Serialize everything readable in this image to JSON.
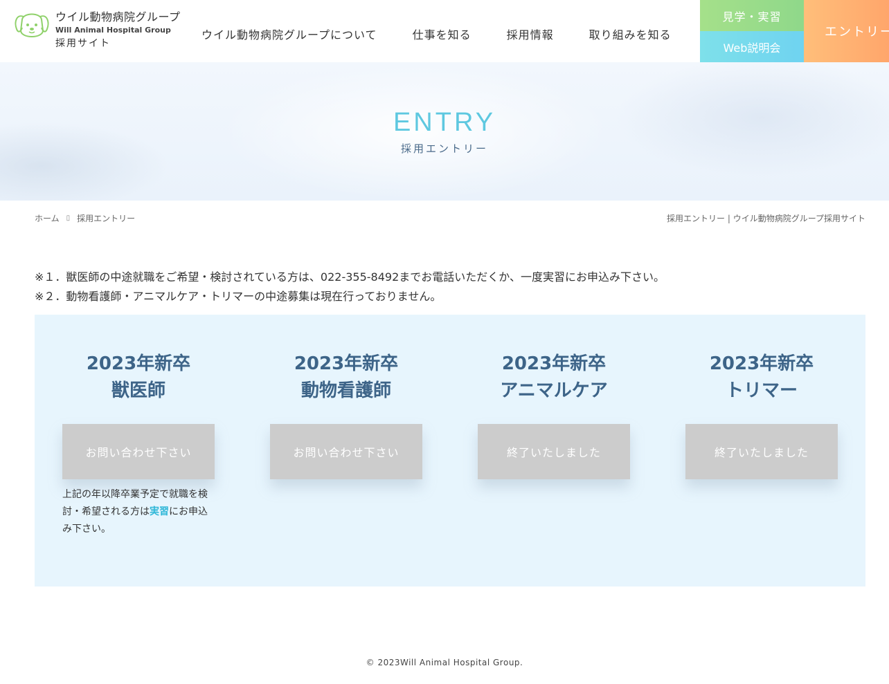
{
  "header": {
    "logo_name": "ウイル動物病院グループ",
    "logo_en": "Will Animal Hospital Group",
    "logo_sub": "採用サイト",
    "nav": [
      {
        "label": "ウイル動物病院グループについて"
      },
      {
        "label": "仕事を知る"
      },
      {
        "label": "採用情報"
      },
      {
        "label": "取り組みを知る"
      }
    ],
    "tour_label": "見学・実習",
    "web_label": "Web説明会",
    "entry_label": "エントリー",
    "colors": {
      "tour": "#a5e08a",
      "web": "#7ee0ea",
      "entry": "#ffa66b",
      "logo": "#8fd16a"
    }
  },
  "hero": {
    "title": "ENTRY",
    "subtitle": "採用エントリー"
  },
  "breadcrumb": {
    "home": "ホーム",
    "current": "採用エントリー",
    "page_title": "採用エントリー | ウイル動物病院グループ採用サイト"
  },
  "notes": [
    "※１．獣医師の中途就職をご希望・検討されている方は、022-355-8492までお電話いただくか、一度実習にお申込み下さい。",
    "※２．動物看護師・アニマルケア・トリマーの中途募集は現在行っておりません。"
  ],
  "entries": [
    {
      "year": "2023年新卒",
      "role": "獣医師",
      "button": "お問い合わせ下さい"
    },
    {
      "year": "2023年新卒",
      "role": "動物看護師",
      "button": "お問い合わせ下さい"
    },
    {
      "year": "2023年新卒",
      "role": "アニマルケア",
      "button": "終了いたしました"
    },
    {
      "year": "2023年新卒",
      "role": "トリマー",
      "button": "終了いたしました"
    }
  ],
  "vet_note": {
    "before": "上記の年以降卒業予定で就職を検討・希望される方は",
    "link": "実習",
    "after": "にお申込み下さい。"
  },
  "footer": {
    "copyright": "© 2023Will Animal Hospital Group."
  }
}
